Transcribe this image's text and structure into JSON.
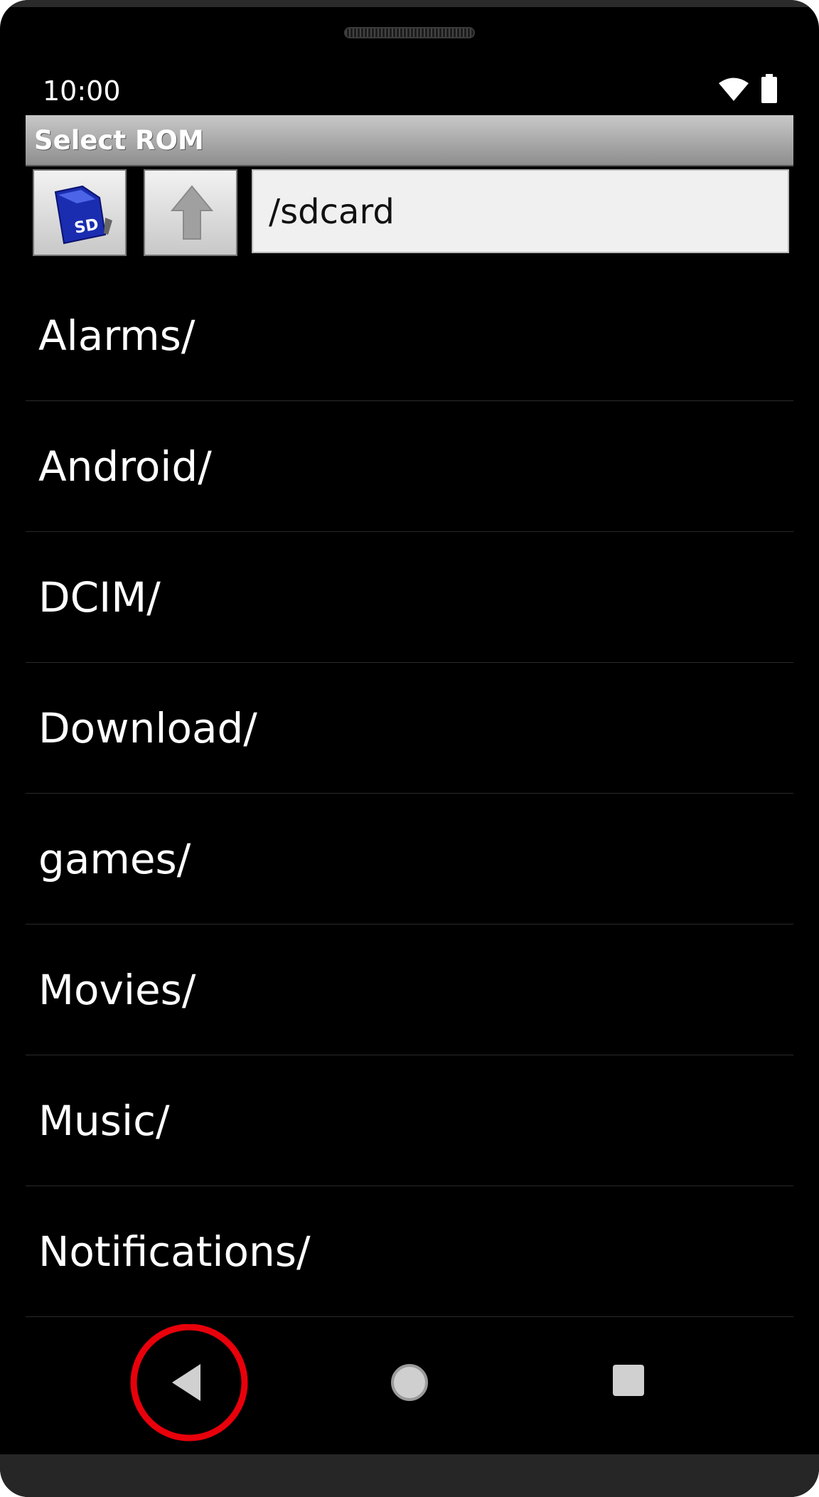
{
  "status_bar": {
    "time": "10:00",
    "wifi_icon": "wifi-icon",
    "battery_icon": "battery-icon"
  },
  "dialog": {
    "title": "Select ROM"
  },
  "toolbar": {
    "sd_card_icon": "sd-card-icon",
    "up_icon": "arrow-up-icon",
    "path": "/sdcard"
  },
  "file_list": {
    "items": [
      {
        "label": "Alarms/"
      },
      {
        "label": "Android/"
      },
      {
        "label": "DCIM/"
      },
      {
        "label": "Download/"
      },
      {
        "label": "games/"
      },
      {
        "label": "Movies/"
      },
      {
        "label": "Music/"
      },
      {
        "label": "Notifications/"
      }
    ]
  },
  "nav_bar": {
    "back_icon": "back-triangle-icon",
    "home_icon": "home-circle-icon",
    "recents_icon": "recents-square-icon",
    "highlight_color": "#e8000b"
  }
}
